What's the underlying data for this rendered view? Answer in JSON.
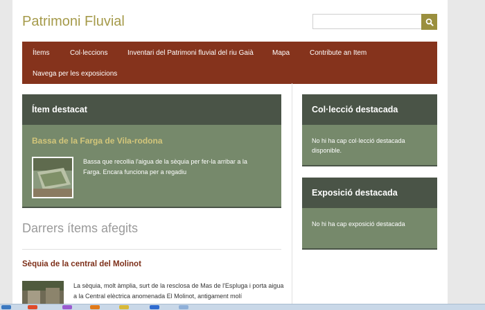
{
  "header": {
    "site_title": "Patrimoni Fluvial",
    "search": {
      "placeholder": "",
      "value": "",
      "button_icon": "search-icon"
    }
  },
  "nav": {
    "items": [
      {
        "label": "Ítems"
      },
      {
        "label": "Col·leccions"
      },
      {
        "label": "Inventari del Patrimoni fluvial del riu Gaià"
      },
      {
        "label": "Mapa"
      },
      {
        "label": "Contribute an Item"
      },
      {
        "label": "Navega per les exposicions"
      }
    ]
  },
  "featured_item": {
    "heading": "Ítem destacat",
    "title": "Bassa de la Farga de Vila-rodona",
    "description": "Bassa que recollia l'aigua de la sèquia per fer-la arribar a la Farga. Encara funciona per a regadiu"
  },
  "featured_collection": {
    "heading": "Col·lecció destacada",
    "body": "No hi ha cap col·lecció destacada disponible."
  },
  "featured_exhibit": {
    "heading": "Exposició destacada",
    "body": "No hi ha cap exposició destacada"
  },
  "recent": {
    "heading": "Darrers ítems afegits",
    "items": [
      {
        "title": "Sèquia de la central del Molinot",
        "description": "La sèquia, molt àmplia, surt de la resclosa de Mas de l'Espluga i porta aigua a la Central elèctrica anomenada El Molinot, antigament molí"
      }
    ]
  },
  "colors": {
    "accent": "#85331c",
    "panel_head": "#4a5447",
    "panel_body": "#76896b",
    "title": "#a59a4a",
    "link": "#7d2f19"
  }
}
